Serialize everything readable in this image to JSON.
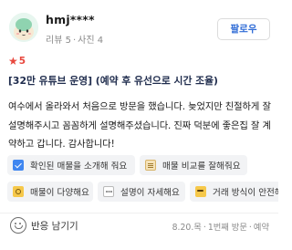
{
  "reviewer": {
    "name": "hmj****",
    "review_label": "리뷰",
    "review_count": "5",
    "photo_label": "사진",
    "photo_count": "4",
    "follow_label": "팔로우"
  },
  "rating": {
    "value": "5",
    "color": "#e8473d"
  },
  "review": {
    "title": "[32만 유튜브 운영] (예약 후 유선으로 시간 조율)",
    "body": "여수에서 올라와서 처음으로 방문을 했습니다. 늦었지만 친절하게 잘 설명해주시고 꼼꼼하게 설명해주셨습니다. 진짜 덕분에 좋은집 잘 계약하고 갑니다. 감사합니다!"
  },
  "tags": [
    {
      "icon": "check-icon",
      "label": "확인된 매물을 소개해 줘요"
    },
    {
      "icon": "clipboard-icon",
      "label": "매물 비교를 잘해줘요"
    },
    {
      "icon": "magnifier-icon",
      "label": "매물이 다양해요"
    },
    {
      "icon": "speech-bubble-icon",
      "label": "설명이 자세해요"
    },
    {
      "icon": "smile-face-icon",
      "label": "거래 방식이 안전해요"
    }
  ],
  "footer": {
    "reaction_label": "반응 남기기",
    "date": "8.20.목",
    "visit": "1번째 방문",
    "method": "예약"
  },
  "colors": {
    "follow_text": "#2e6bd6",
    "title_text": "#1f2c4d",
    "tag_bg": "#f2f3f5"
  }
}
